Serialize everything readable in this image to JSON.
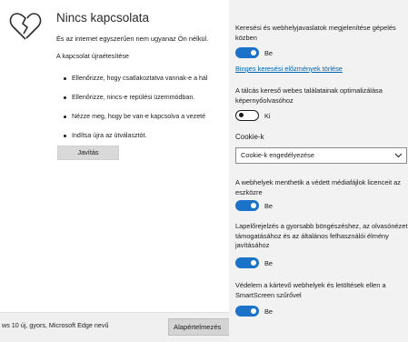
{
  "error_page": {
    "title": "Nincs kapcsolata",
    "description": "És az internet egyszerűen nem ugyanaz Ön nélkül.",
    "subheading": "A kapcsolat újraétesítése",
    "checklist": [
      "Ellenőrizze, hogy csatlakoztatva vannak-e a hál",
      "Ellenőrizze, nincs-e repülési üzemmódban.",
      "Nézze meg, hogy be van-e kapcsolva a vezeté",
      "Indítsa újra az útválasztót."
    ],
    "fix_button": "Javítás"
  },
  "notification_bar": {
    "text": "ws 10 új, gyors, Microsoft Edge nevű",
    "default_button": "Alapértelmezés"
  },
  "settings": {
    "search_suggestions": {
      "label": "Keresési és webhelyjavaslatok megjelenítése gépelés közben",
      "toggle_state": "on",
      "toggle_label": "Be"
    },
    "clear_history_link": "Binges keresési előzmények törlése",
    "taskbar_optimize": {
      "label": "A tálcás kereső webes találatainak optimalizálása képernyőolvasóhoz",
      "toggle_state": "off",
      "toggle_label": "Ki"
    },
    "cookies": {
      "label": "Cookie-k",
      "selected": "Cookie-k engedélyezése"
    },
    "media_licenses": {
      "label": "A webhelyek menthetik a védett médiafájlok licenceit az eszközre",
      "toggle_state": "on",
      "toggle_label": "Be"
    },
    "page_prediction": {
      "label": "Lapelőrejelzés a gyorsabb böngészéshez, az olvasónézet támogatásához és az általános felhasználói élmény javításához",
      "toggle_state": "on",
      "toggle_label": "Be"
    },
    "smartscreen": {
      "label": "Védelem a kártevő webhelyek és letöltések ellen a SmartScreen szűrővel",
      "toggle_state": "on",
      "toggle_label": "Be"
    }
  },
  "colors": {
    "accent": "#1a73c8",
    "link": "#0063b1",
    "pane_bg": "#f2f2f2"
  },
  "icons": {
    "error": "broken-heart-icon",
    "dropdown": "chevron-down-icon"
  }
}
